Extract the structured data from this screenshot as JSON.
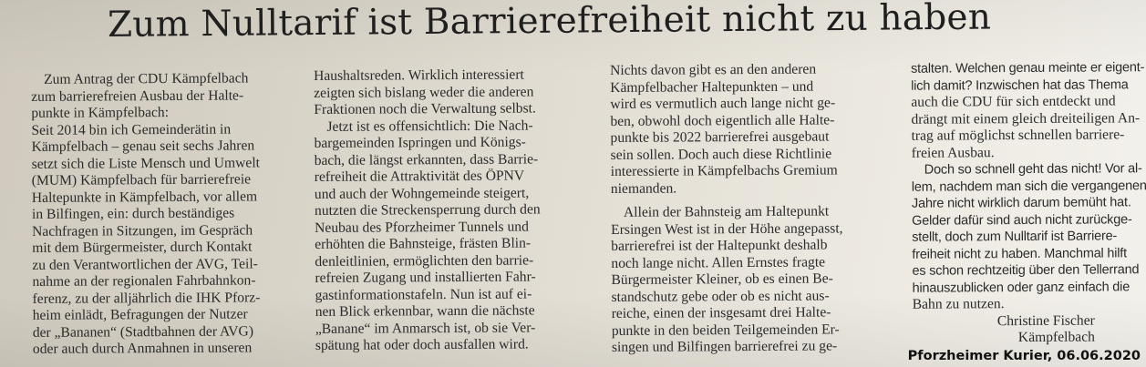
{
  "headline": "Zum Nulltarif ist Barrierefreiheit nicht zu haben",
  "columns": [
    [
      "Zum Antrag der CDU Kämpfelbach",
      "zum barrierefreien Ausbau der Halte-",
      "punkte in Kämpfelbach:",
      "Seit 2014 bin ich Gemeinderätin in",
      "Kämpfelbach – genau seit sechs Jahren",
      "setzt sich die Liste Mensch und Umwelt",
      "(MUM) Kämpfelbach für barrierefreie",
      "Haltepunkte in Kämpfelbach, vor allem",
      "in Bilfingen, ein: durch beständiges",
      "Nachfragen in Sitzungen, im Gespräch",
      "mit dem Bürgermeister, durch Kontakt",
      "zu den Verantwortlichen der AVG, Teil-",
      "nahme an der regionalen Fahrbahnkon-",
      "ferenz, zu der alljährlich die IHK Pforz-",
      "heim einlädt, Befragungen der Nutzer",
      "der „Bananen“ (Stadtbahnen der AVG)",
      "oder auch durch Anmahnen in unseren"
    ],
    [
      "Haushaltsreden. Wirklich interessiert",
      "zeigten sich bislang weder die anderen",
      "Fraktionen noch die Verwaltung selbst.",
      "Jetzt ist es offensichtlich: Die Nach-",
      "bargemeinden Ispringen und Königs-",
      "bach, die längst erkannten, dass Barrie-",
      "refreiheit die Attraktivität des ÖPNV",
      "und auch der Wohngemeinde steigert,",
      "nutzten die Streckensperrung durch den",
      "Neubau des Pforzheimer Tunnels und",
      "erhöhten die Bahnsteige, frästen Blin-",
      "denleitlinien, ermöglichten den barrie-",
      "refreien Zugang und installierten Fahr-",
      "gastinformationstafeln. Nun ist auf ei-",
      "nen Blick erkennbar, wann die nächste",
      "„Banane“ im Anmarsch ist, ob sie Ver-",
      "spätung hat oder doch ausfallen wird."
    ],
    [
      "Nichts davon gibt es an den anderen",
      "Kämpfelbacher Haltepunkten – und",
      "wird es vermutlich auch lange nicht ge-",
      "ben, obwohl doch eigentlich alle Halte-",
      "punkte bis 2022 barrierefrei ausgebaut",
      "sein sollen. Doch auch diese Richtlinie",
      "interessierte in Kämpfelbachs Gremium",
      "niemanden.",
      "Allein der Bahnsteig am Haltepunkt",
      "Ersingen West ist in der Höhe angepasst,",
      "barrierefrei ist der Haltepunkt deshalb",
      "noch lange nicht. Allen Ernstes fragte",
      "Bürgermeister Kleiner, ob es einen Be-",
      "standschutz gebe oder ob es nicht aus-",
      "reiche, einen der insgesamt drei Halte-",
      "punkte in den beiden Teilgemeinden Er-",
      "singen und Bilfingen barrierefrei zu ge-"
    ],
    [
      "stalten. Welchen genau meinte er eigent-",
      "lich damit? Inzwischen hat das Thema",
      "auch die CDU für sich entdeckt und",
      "drängt mit einem gleich dreiteiligen An-",
      "trag auf möglichst schnellen barriere-",
      "freien Ausbau.",
      "Doch so schnell geht das nicht! Vor al-",
      "lem, nachdem man sich die vergangenen",
      "Jahre nicht wirklich darum bemüht hat.",
      "Gelder dafür sind auch nicht zurückge-",
      "stellt, doch zum Nulltarif ist Barriere-",
      "freiheit nicht zu haben. Manchmal hilft",
      "es schon rechtzeitig über den Tellerrand",
      "hinauszublicken oder ganz einfach die",
      "Bahn zu nutzen."
    ]
  ],
  "author": "Christine Fischer",
  "location": "Kämpfelbach",
  "source_caption": "Pforzheimer Kurier, 06.06.2020"
}
